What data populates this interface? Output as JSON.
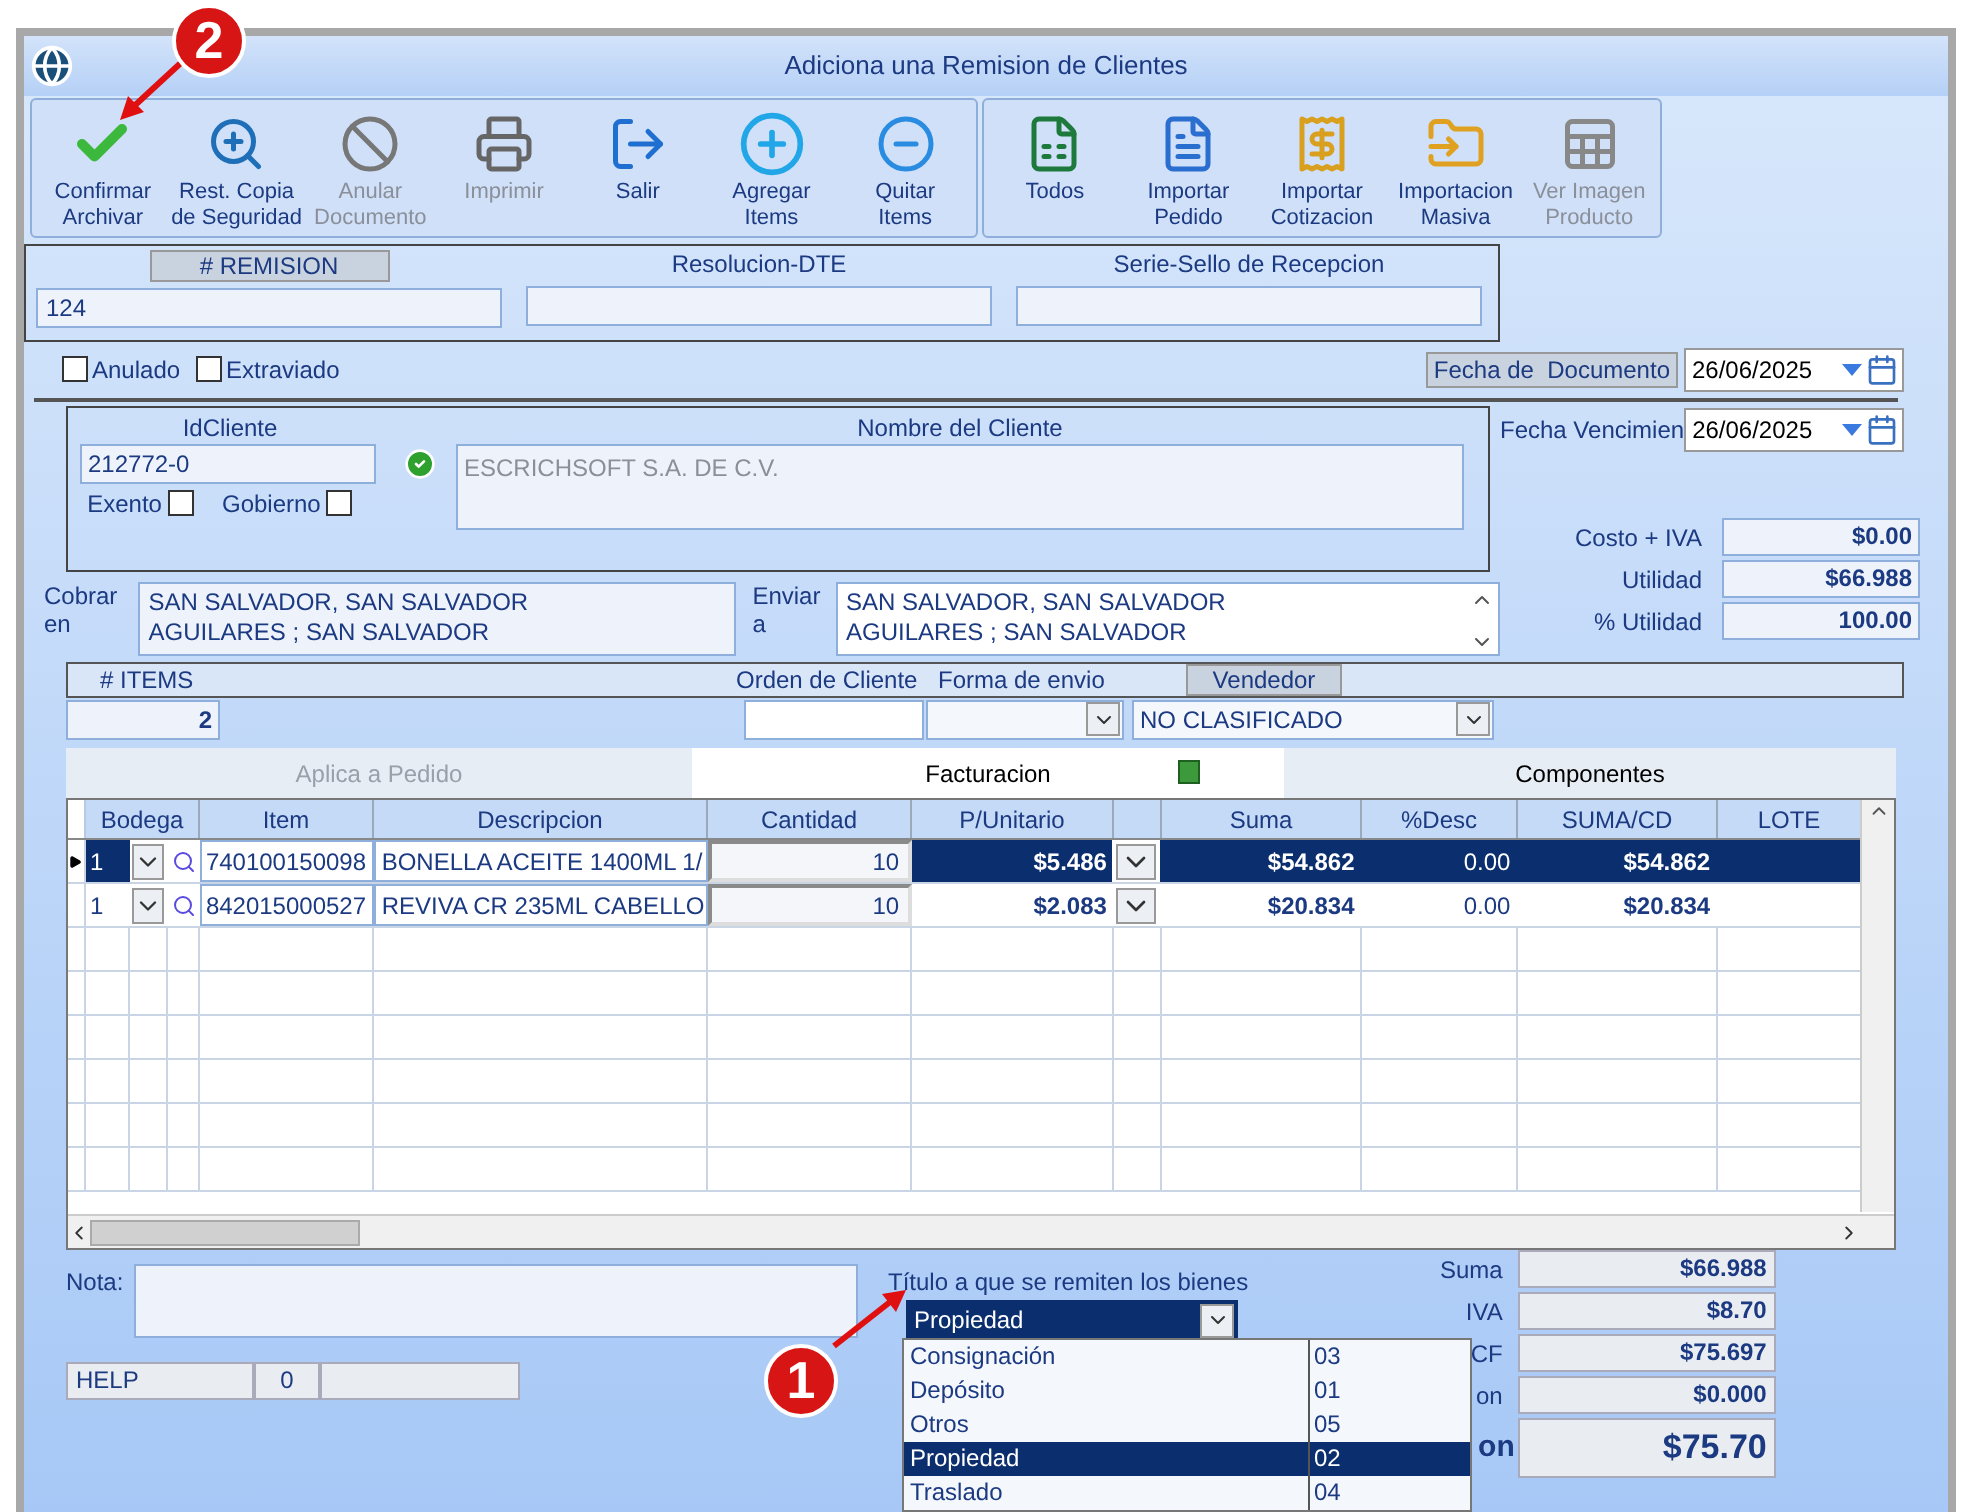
{
  "window": {
    "title": "Adiciona una Remision de Clientes"
  },
  "toolbar": [
    {
      "lines": [
        "Confirmar",
        "Archivar"
      ],
      "disabled": false
    },
    {
      "lines": [
        "Rest. Copia",
        "de Seguridad"
      ],
      "disabled": false
    },
    {
      "lines": [
        "Anular",
        "Documento"
      ],
      "disabled": true
    },
    {
      "lines": [
        "Imprimir"
      ],
      "disabled": true
    },
    {
      "lines": [
        "Salir"
      ],
      "disabled": false
    },
    {
      "lines": [
        "Agregar",
        "Items"
      ],
      "disabled": false
    },
    {
      "lines": [
        "Quitar",
        "Items"
      ],
      "disabled": false
    }
  ],
  "toolbar_import": [
    {
      "lines": [
        "Todos"
      ],
      "disabled": false
    },
    {
      "lines": [
        "Importar",
        "Pedido"
      ],
      "disabled": false
    },
    {
      "lines": [
        "Importar",
        "Cotizacion"
      ],
      "disabled": false
    },
    {
      "lines": [
        "Importacion",
        "Masiva"
      ],
      "disabled": false
    },
    {
      "lines": [
        "Ver Imagen",
        "Producto"
      ],
      "disabled": true
    }
  ],
  "header": {
    "remision_label": "# REMISION",
    "remision": "124",
    "resolucion_label": "Resolucion-DTE",
    "serie_label": "Serie-Sello de Recepcion"
  },
  "flags": [
    {
      "label": "Anulado",
      "checked": false
    },
    {
      "label": "Extraviado",
      "checked": false
    }
  ],
  "fecha_documento": {
    "label": "Fecha de  Documento",
    "value": "26/06/2025"
  },
  "client": {
    "id_label": "IdCliente",
    "id": "212772-0",
    "name_label": "Nombre del Cliente",
    "name": "ESCRICHSOFT S.A. DE C.V.",
    "checks": [
      {
        "label": "Exento",
        "checked": false
      },
      {
        "label": "Gobierno",
        "checked": false
      }
    ]
  },
  "fecha_vencimiento": {
    "label": "Fecha Vencimien",
    "value": "26/06/2025"
  },
  "margins": [
    {
      "label": "Costo + IVA",
      "value": "$0.00"
    },
    {
      "label": "Utilidad",
      "value": "$66.988"
    },
    {
      "label": "% Utilidad",
      "value": "100.00"
    }
  ],
  "cobrar": {
    "label": [
      "Cobrar",
      "en"
    ],
    "lines": [
      "SAN SALVADOR, SAN SALVADOR",
      "AGUILARES ; SAN SALVADOR"
    ]
  },
  "enviar": {
    "label": [
      "Enviar",
      "a"
    ],
    "lines": [
      "SAN SALVADOR, SAN SALVADOR",
      "AGUILARES ; SAN SALVADOR"
    ]
  },
  "items_bar": {
    "items_label": "# ITEMS",
    "items_count": "2",
    "orden_label": "Orden de Cliente",
    "forma_label": "Forma de envio",
    "vendedor_label": "Vendedor",
    "vendedor": "NO CLASIFICADO"
  },
  "tabs": [
    {
      "label": "Aplica a Pedido",
      "selected": false,
      "disabled": true
    },
    {
      "label": "Facturacion",
      "selected": true,
      "disabled": false
    },
    {
      "label": "Componentes",
      "selected": false,
      "disabled": false
    }
  ],
  "grid": {
    "columns": [
      "Bodega",
      "Item",
      "Descripcion",
      "Cantidad",
      "P/Unitario",
      "Suma",
      "%Desc",
      "SUMA/CD",
      "LOTE"
    ],
    "rows": [
      {
        "selected": true,
        "bodega": "1",
        "item": "740100150098",
        "descripcion": "BONELLA ACEITE 1400ML 1/",
        "cantidad": "10",
        "precio": "$5.486",
        "suma": "$54.862",
        "desc": "0.00",
        "suma_cd": "$54.862"
      },
      {
        "selected": false,
        "bodega": "1",
        "item": "842015000527",
        "descripcion": "REVIVA CR 235ML CABELLO",
        "cantidad": "10",
        "precio": "$2.083",
        "suma": "$20.834",
        "desc": "0.00",
        "suma_cd": "$20.834"
      }
    ]
  },
  "nota": {
    "label": "Nota:"
  },
  "status": [
    "HELP",
    "0"
  ],
  "titulo": {
    "label": "Título a que se remiten los bienes",
    "value": "Propiedad",
    "options": [
      {
        "label": "Consignación",
        "code": "03",
        "selected": false
      },
      {
        "label": "Depósito",
        "code": "01",
        "selected": false
      },
      {
        "label": "Otros",
        "code": "05",
        "selected": false
      },
      {
        "label": "Propiedad",
        "code": "02",
        "selected": true
      },
      {
        "label": "Traslado",
        "code": "04",
        "selected": false
      }
    ]
  },
  "totals": [
    {
      "label": "Suma",
      "value": "$66.988",
      "kind": "line"
    },
    {
      "label": "IVA",
      "value": "$8.70",
      "kind": "line"
    },
    {
      "label": "CF",
      "value": "$75.697",
      "kind": "line"
    },
    {
      "label": "on",
      "value": "$0.000",
      "kind": "line"
    },
    {
      "label": "on",
      "value": "$75.70",
      "kind": "grand"
    }
  ],
  "annotations": [
    {
      "label": "2"
    },
    {
      "label": "1"
    }
  ]
}
